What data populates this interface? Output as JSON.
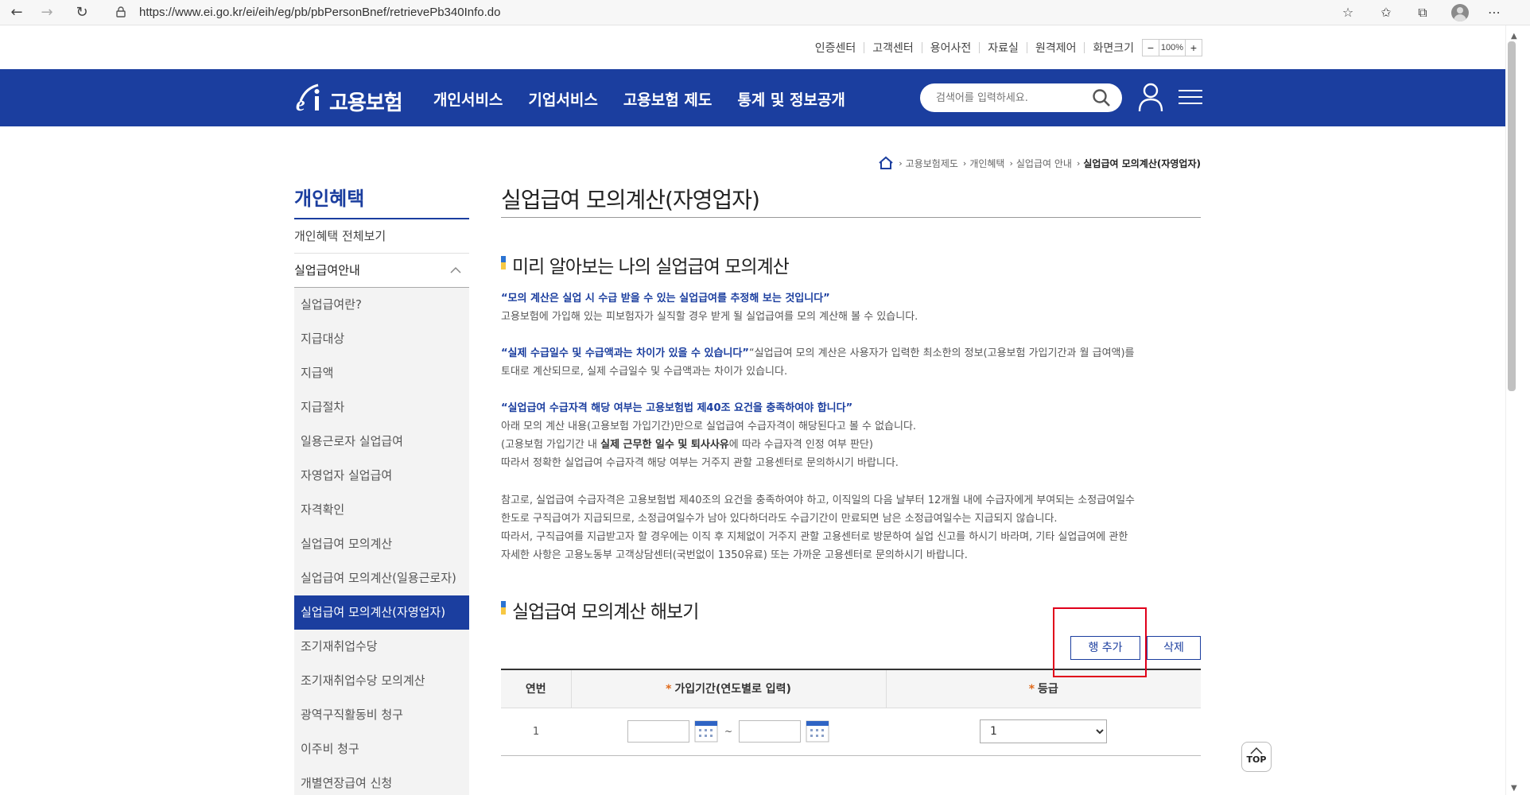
{
  "browser": {
    "url": "https://www.ei.go.kr/ei/eih/eg/pb/pbPersonBnef/retrievePb340Info.do"
  },
  "util": {
    "links": [
      "인증센터",
      "고객센터",
      "용어사전",
      "자료실",
      "원격제어"
    ],
    "font_size_label": "화면크기",
    "zoom_minus": "−",
    "zoom_value": "100%",
    "zoom_plus": "+"
  },
  "header": {
    "logo_text": "고용보험",
    "menu": [
      "개인서비스",
      "기업서비스",
      "고용보험 제도",
      "통계 및 정보공개"
    ],
    "search_placeholder": "검색어를 입력하세요."
  },
  "breadcrumb": {
    "items": [
      "고용보험제도",
      "개인혜택",
      "실업급여 안내"
    ],
    "current": "실업급여 모의계산(자영업자)"
  },
  "sidebar": {
    "title": "개인혜택",
    "all_link": "개인혜택 전체보기",
    "group": "실업급여안내",
    "items": [
      "실업급여란?",
      "지급대상",
      "지급액",
      "지급절차",
      "일용근로자 실업급여",
      "자영업자 실업급여",
      "자격확인",
      "실업급여 모의계산",
      "실업급여 모의계산(일용근로자)",
      "실업급여 모의계산(자영업자)",
      "조기재취업수당",
      "조기재취업수당 모의계산",
      "광역구직활동비 청구",
      "이주비 청구",
      "개별연장급여 신청"
    ],
    "active_index": 9
  },
  "content": {
    "page_title": "실업급여 모의계산(자영업자)",
    "section1_title": "미리 알아보는 나의 실업급여 모의계산",
    "p1_emph": "“모의 계산은 실업 시 수급 받을 수 있는 실업급여를 추정해 보는 것입니다”",
    "p1_text": "고용보험에 가입해 있는 피보험자가 실직할 경우 받게 될 실업급여를 모의 계산해 볼 수 있습니다.",
    "p2_emph": "“실제 수급일수 및 수급액과는 차이가 있을 수 있습니다”",
    "p2_text_a": "“실업급여 모의 계산은 사용자가 입력한 최소한의 정보(고용보험 가입기간과 월 급여액)를",
    "p2_text_b": "토대로 계산되므로, 실제 수급일수 및 수급액과는 차이가 있습니다.",
    "p3_emph": "“실업급여 수급자격 해당 여부는 고용보험법 제40조 요건을 충족하여야 합니다”",
    "p3_line1": "아래 모의 계산 내용(고용보험 가입기간)만으로 실업급여 수급자격이 해당된다고 볼 수 없습니다.",
    "p3_line2_a": "(고용보험 가입기간 내 ",
    "p3_line2_b": "실제 근무한 일수 및 퇴사사유",
    "p3_line2_c": "에 따라 수급자격 인정 여부 판단)",
    "p3_line3": "따라서 정확한 실업급여 수급자격 해당 여부는 거주지 관할 고용센터로 문의하시기 바랍니다.",
    "p4_line1": "참고로, 실업급여 수급자격은 고용보험법 제40조의 요건을 충족하여야 하고, 이직일의 다음 날부터 12개월 내에 수급자에게 부여되는 소정급여일수",
    "p4_line2": "한도로 구직급여가 지급되므로, 소정급여일수가 남아 있다하더라도 수급기간이 만료되면 남은 소정급여일수는 지급되지 않습니다.",
    "p4_line3": "따라서, 구직급여를 지급받고자 할 경우에는 이직 후 지체없이 거주지 관할 고용센터로 방문하여 실업 신고를 하시기 바라며, 기타 실업급여에 관한",
    "p4_line4": "자세한 사항은 고용노동부 고객상담센터(국번없이 1350유료) 또는 가까운 고용센터로 문의하시기 바랍니다.",
    "section2_title": "실업급여 모의계산 해보기",
    "btn_add": "행 추가",
    "btn_delete": "삭제",
    "table": {
      "col_no": "연번",
      "col_period": "가입기간(연도별로 입력)",
      "col_grade": "등급",
      "required_mark": "*",
      "rows": [
        {
          "no": "1",
          "tilde": "~",
          "grade": "1"
        }
      ]
    }
  },
  "top_button": "TOP"
}
